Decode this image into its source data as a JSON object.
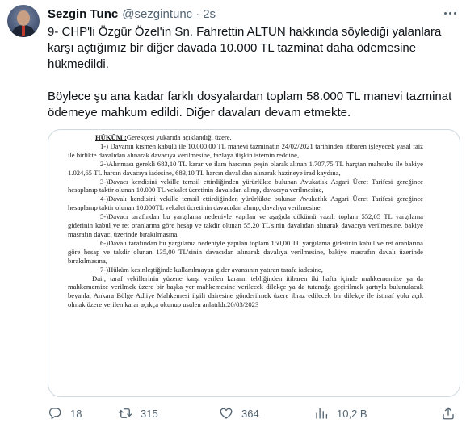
{
  "author": {
    "name": "Sezgin Tunc",
    "handle": "@sezgintunc",
    "separator": "·",
    "time": "2s"
  },
  "tweet": {
    "paragraph1": "9- CHP'li Özgür Özel'in Sn. Fahrettin ALTUN hakkında söylediği yalanlara karşı açtığımız bir diğer davada 10.000 TL tazminat daha ödemesine hükmedildi.",
    "paragraph2": "Böylece şu ana kadar farklı dosyalardan toplam 58.000 TL manevi tazminat ödemeye mahkum edildi. Diğer davaları devam etmekte."
  },
  "document": {
    "hukum_label": "HÜKÜM :",
    "hukum_intro": "Gerekçesi yukarıda açıklandığı üzere,",
    "items": [
      "1-) Davanın kısmen kabulü ile 10.000,00 TL manevi tazminatın 24/02/2021 tarihinden itibaren işleyecek yasal faiz ile birlikte davalıdan alınarak davacıya verilmesine, fazlaya ilişkin istemin reddine,",
      "2-)Alınması gerekli 683,10 TL karar ve ilam harcının peşin olarak alınan 1.707,75 TL harçtan mahsubu ile bakiye 1.024,65 TL harcın davacıya iadesine, 683,10 TL harcın davalıdan alınarak hazineye irad kaydına,",
      "3-)Davacı kendisini vekille temsil ettirdiğinden yürürlükte bulunan Avukatlık Asgari Ücret Tarifesi gereğince hesaplanıp taktir olunan 10.000 TL vekalet ücretinin davalıdan alınıp, davacıya verilmesine,",
      "4-)Davalı kendisini vekille temsil ettirdiğinden yürürlükte bulunan Avukatlık Asgari Ücret Tarifesi gereğince hesaplanıp taktir olunan 10.000TL vekalet ücretinin davacıdan alınıp, davalıya verilmesine,",
      "5-)Davacı tarafından bu yargılama nedeniyle yapılan ve aşağıda dökümü yazılı toplam 552,05 TL yargılama giderinin kabul ve ret oranlarına göre hesap ve takdir olunan 55,20 TL'sinin davalıdan alınarak davacıya verilmesine, bakiye masrafın davacı üzerinde bırakılmasına,",
      "6-)Davalı tarafından bu yargılama nedeniyle yapılan toplam 150,00 TL yargılama giderinin kabul ve ret oranlarına göre hesap ve takdir olunan 135,00 TL'sinin davacıdan alınarak davalıya verilmesine, bakiye masrafın davalı üzerinde bırakılmasına,",
      "7-)Hüküm kesinleştiğinde kullanılmayan gider avansının yatıran tarafa iadesine,",
      "Dair, taraf vekillerinin yüzene karşı verilen kararın tebliğinden itibaren iki hafta içinde mahkememize ya da mahkememize verilmek üzere bir başka yer mahkemesine verilecek dilekçe ya da tutanağa geçirilmek şartıyla bulunulacak beyanla, Ankara Bölge Adliye Mahkemesi ilgili dairesine gönderilmek üzere ibraz edilecek bir dilekçe ile istinaf yolu açık olmak üzere verilen karar açıkça okunup usulen anlatıldı.20/03/2023"
    ]
  },
  "actions": {
    "replies": "18",
    "retweets": "315",
    "likes": "364",
    "views": "10,2 B"
  },
  "colors": {
    "text": "#0f1419",
    "secondary": "#536471",
    "border": "#cfd9de"
  }
}
